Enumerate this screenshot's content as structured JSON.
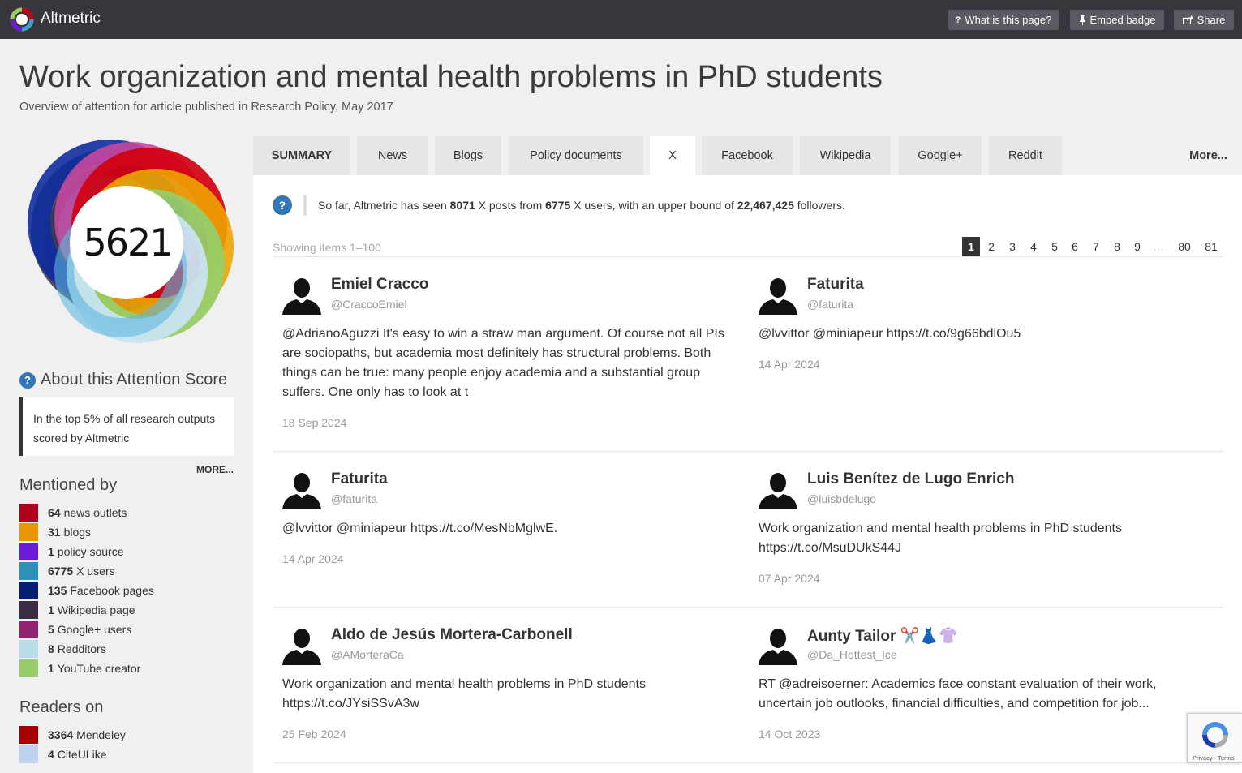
{
  "header": {
    "brand": "Altmetric",
    "buttons": [
      {
        "icon": "question-icon",
        "label": "What is this page?"
      },
      {
        "icon": "pin-icon",
        "label": "Embed badge"
      },
      {
        "icon": "share-icon",
        "label": "Share"
      }
    ]
  },
  "article": {
    "title": "Work organization and mental health problems in PhD students",
    "subtitle": "Overview of attention for article published in Research Policy, May 2017"
  },
  "score": "5621",
  "about": {
    "heading": "About this Attention Score",
    "text": "In the top 5% of all research outputs scored by Altmetric",
    "more": "MORE..."
  },
  "mentioned_by": {
    "heading": "Mentioned by",
    "items": [
      {
        "count": "64",
        "label": "news outlets",
        "color": "#b0001a"
      },
      {
        "count": "31",
        "label": "blogs",
        "color": "#e89500"
      },
      {
        "count": "1",
        "label": "policy source",
        "color": "#6a1cd9"
      },
      {
        "count": "6775",
        "label": "X users",
        "color": "#2f90b9"
      },
      {
        "count": "135",
        "label": "Facebook pages",
        "color": "#071d70"
      },
      {
        "count": "1",
        "label": "Wikipedia page",
        "color": "#3a2c44"
      },
      {
        "count": "5",
        "label": "Google+ users",
        "color": "#912470"
      },
      {
        "count": "8",
        "label": "Redditors",
        "color": "#b9dcea"
      },
      {
        "count": "1",
        "label": "YouTube creator",
        "color": "#98cc68"
      }
    ]
  },
  "readers_on": {
    "heading": "Readers on",
    "items": [
      {
        "count": "3364",
        "label": "Mendeley",
        "color": "#a60000"
      },
      {
        "count": "4",
        "label": "CiteULike",
        "color": "#bcd2ef"
      }
    ]
  },
  "tabs": [
    "SUMMARY",
    "News",
    "Blogs",
    "Policy documents",
    "X",
    "Facebook",
    "Wikipedia",
    "Google+",
    "Reddit",
    "More..."
  ],
  "active_tab": "X",
  "info": {
    "p1": "So far, Altmetric has seen ",
    "posts": "8071",
    "p2": " X posts from ",
    "users": "6775",
    "p3": " X users, with an upper bound of ",
    "followers": "22,467,425",
    "p4": " followers."
  },
  "showing": "Showing items 1–100",
  "pagination": [
    "1",
    "2",
    "3",
    "4",
    "5",
    "6",
    "7",
    "8",
    "9",
    "…",
    "80",
    "81"
  ],
  "posts": [
    {
      "name": "Emiel Cracco",
      "handle": "@CraccoEmiel",
      "text": "@AdrianoAguzzi It's easy to win a straw man argument. Of course not all PIs are sociopaths, but academia most definitely has structural problems. Both things can be true: many people enjoy academia and a substantial group suffers. One only has to look at t",
      "date": "18 Sep 2024"
    },
    {
      "name": "Faturita",
      "handle": "@faturita",
      "text": "@lvvittor @miniapeur https://t.co/9g66bdlOu5",
      "date": "14 Apr 2024"
    },
    {
      "name": "Faturita",
      "handle": "@faturita",
      "text": "@lvvittor @miniapeur https://t.co/MesNbMglwE.",
      "date": "14 Apr 2024"
    },
    {
      "name": "Luis Benítez de Lugo Enrich",
      "handle": "@luisbdelugo",
      "text": "Work organization and mental health problems in PhD students https://t.co/MsuDUkS44J",
      "date": "07 Apr 2024"
    },
    {
      "name": "Aldo de Jesús Mortera-Carbonell",
      "handle": "@AMorteraCa",
      "text": "Work organization and mental health problems in PhD students https://t.co/JYsiSSvA3w",
      "date": "25 Feb 2024"
    },
    {
      "name": "Aunty Tailor ✂️👗👚",
      "handle": "@Da_Hottest_Ice",
      "text": "RT @adreisoerner: Academics face constant evaluation of their work, uncertain job outlooks, financial difficulties, and competition for job...",
      "date": "14 Oct 2023"
    }
  ],
  "recaptcha": {
    "links": "Privacy - Terms"
  }
}
